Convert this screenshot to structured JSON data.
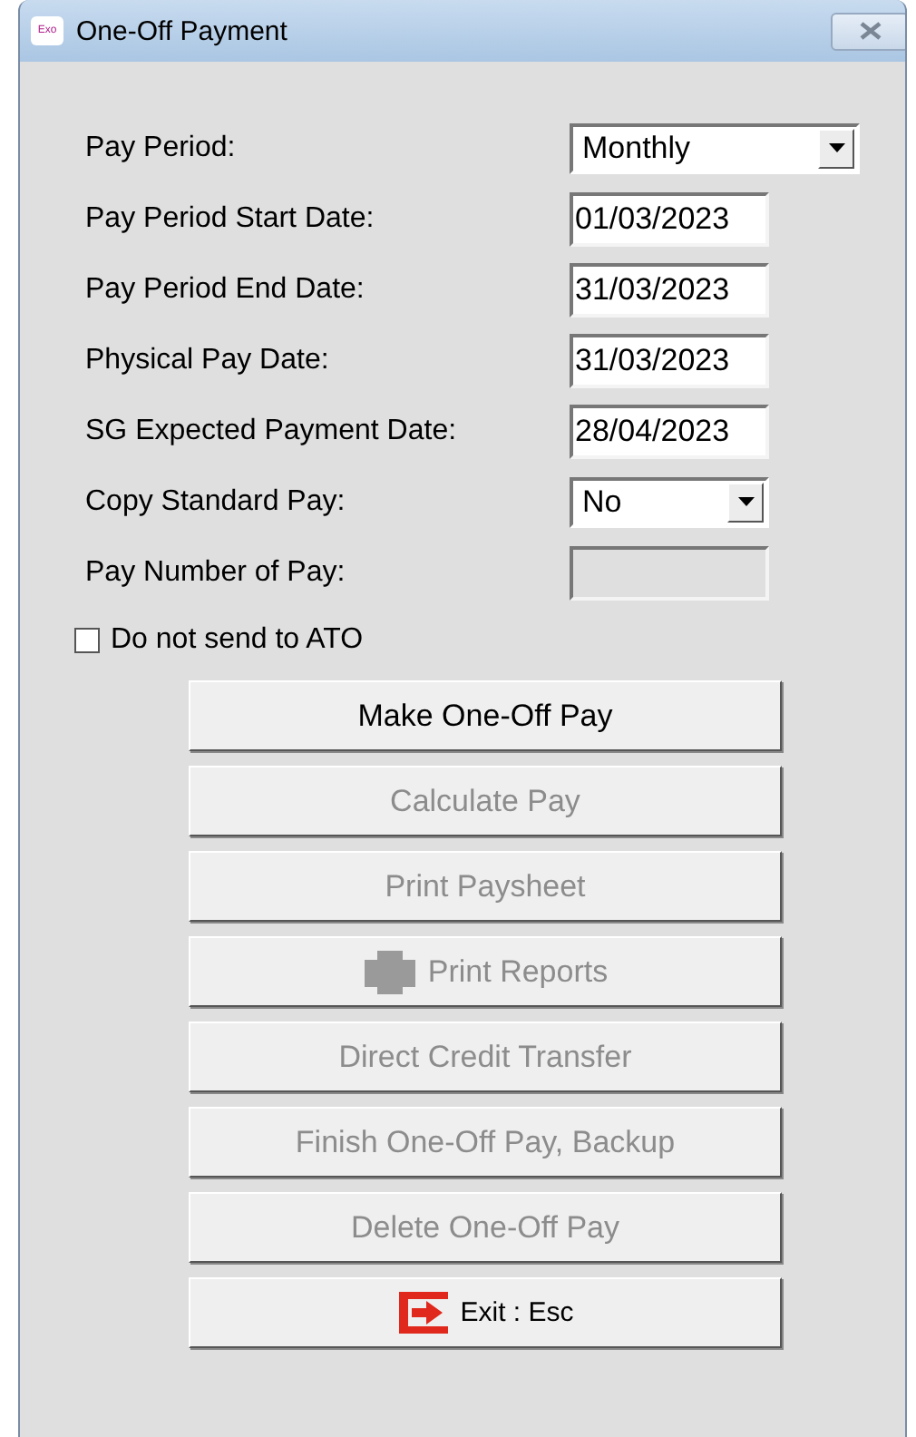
{
  "window": {
    "title": "One-Off Payment",
    "logo_text": "Exo"
  },
  "fields": [
    {
      "label": "Pay Period:",
      "kind": "combo",
      "value": "Monthly",
      "disabled": false
    },
    {
      "label": "Pay Period Start Date:",
      "kind": "text",
      "value": "01/03/2023",
      "disabled": false
    },
    {
      "label": "Pay Period End Date:",
      "kind": "text",
      "value": "31/03/2023",
      "disabled": false
    },
    {
      "label": "Physical Pay Date:",
      "kind": "text",
      "value": "31/03/2023",
      "disabled": false
    },
    {
      "label": "SG Expected Payment Date:",
      "kind": "text",
      "value": "28/04/2023",
      "disabled": false
    },
    {
      "label": "Copy Standard Pay:",
      "kind": "dropdown",
      "value": "No",
      "disabled": false
    },
    {
      "label": "Pay Number of Pay:",
      "kind": "text",
      "disabled": true
    }
  ],
  "checkbox": {
    "label": "Do not send to ATO",
    "checked": false
  },
  "buttons": [
    {
      "label": "Make One-Off Pay",
      "disabled": false,
      "kind": "plain"
    },
    {
      "label": "Calculate Pay",
      "disabled": true,
      "kind": "plain"
    },
    {
      "label": "Print Paysheet",
      "disabled": true,
      "kind": "plain"
    },
    {
      "label": "Print Reports",
      "disabled": true,
      "kind": "print"
    },
    {
      "label": "Direct Credit Transfer",
      "disabled": true,
      "kind": "plain"
    },
    {
      "label": "Finish One-Off Pay, Backup",
      "disabled": true,
      "kind": "plain"
    },
    {
      "label": "Delete One-Off Pay",
      "disabled": true,
      "kind": "plain"
    },
    {
      "label": "Exit : Esc",
      "disabled": false,
      "kind": "exit"
    }
  ]
}
